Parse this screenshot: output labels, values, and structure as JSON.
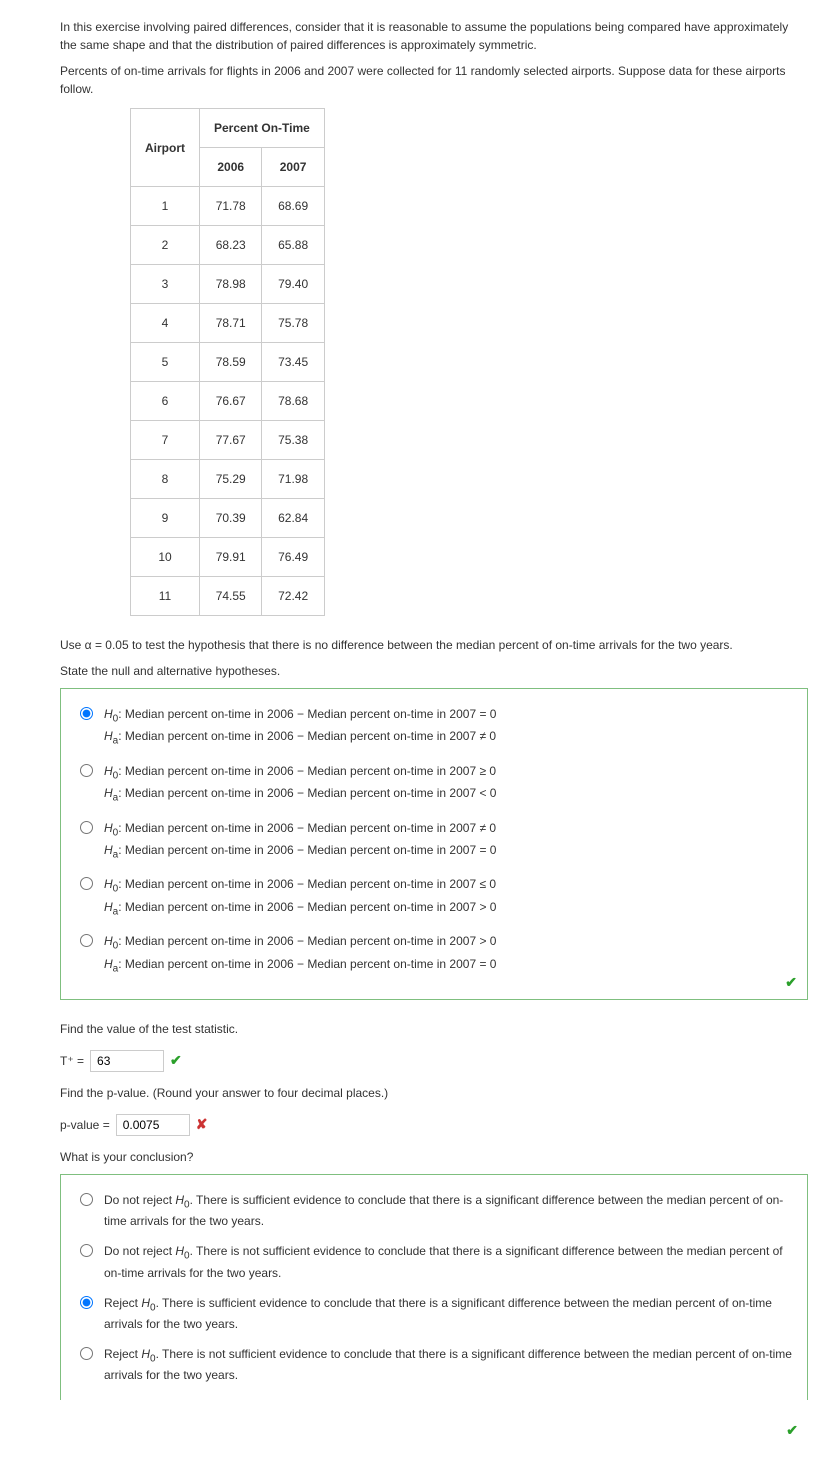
{
  "intro": {
    "p1": "In this exercise involving paired differences, consider that it is reasonable to assume the populations being compared have approximately the same shape and that the distribution of paired differences is approximately symmetric.",
    "p2": "Percents of on-time arrivals for flights in 2006 and 2007 were collected for 11 randomly selected airports. Suppose data for these airports follow."
  },
  "table": {
    "col_airport": "Airport",
    "col_group": "Percent On-Time",
    "col_2006": "2006",
    "col_2007": "2007",
    "rows": [
      {
        "airport": "1",
        "y2006": "71.78",
        "y2007": "68.69"
      },
      {
        "airport": "2",
        "y2006": "68.23",
        "y2007": "65.88"
      },
      {
        "airport": "3",
        "y2006": "78.98",
        "y2007": "79.40"
      },
      {
        "airport": "4",
        "y2006": "78.71",
        "y2007": "75.78"
      },
      {
        "airport": "5",
        "y2006": "78.59",
        "y2007": "73.45"
      },
      {
        "airport": "6",
        "y2006": "76.67",
        "y2007": "78.68"
      },
      {
        "airport": "7",
        "y2006": "77.67",
        "y2007": "75.38"
      },
      {
        "airport": "8",
        "y2006": "75.29",
        "y2007": "71.98"
      },
      {
        "airport": "9",
        "y2006": "70.39",
        "y2007": "62.84"
      },
      {
        "airport": "10",
        "y2006": "79.91",
        "y2007": "76.49"
      },
      {
        "airport": "11",
        "y2006": "74.55",
        "y2007": "72.42"
      }
    ]
  },
  "q": {
    "alpha_line": "Use α = 0.05 to test the hypothesis that there is no difference between the median percent of on-time arrivals for the two years.",
    "state_line": "State the null and alternative hypotheses.",
    "hyp": [
      {
        "h0": "Median percent on-time in 2006 − Median percent on-time in 2007 = 0",
        "ha": "Median percent on-time in 2006 − Median percent on-time in 2007 ≠ 0"
      },
      {
        "h0": "Median percent on-time in 2006 − Median percent on-time in 2007 ≥ 0",
        "ha": "Median percent on-time in 2006 − Median percent on-time in 2007 < 0"
      },
      {
        "h0": "Median percent on-time in 2006 − Median percent on-time in 2007 ≠ 0",
        "ha": "Median percent on-time in 2006 − Median percent on-time in 2007 = 0"
      },
      {
        "h0": "Median percent on-time in 2006 − Median percent on-time in 2007 ≤ 0",
        "ha": "Median percent on-time in 2006 − Median percent on-time in 2007 > 0"
      },
      {
        "h0": "Median percent on-time in 2006 − Median percent on-time in 2007 > 0",
        "ha": "Median percent on-time in 2006 − Median percent on-time in 2007 = 0"
      }
    ],
    "hyp_selected": 0,
    "find_stat": "Find the value of the test statistic.",
    "stat_prefix": "T⁺ = ",
    "stat_value": "63",
    "find_p": "Find the p-value. (Round your answer to four decimal places.)",
    "p_prefix": "p-value = ",
    "p_value": "0.0075",
    "conclusion_q": "What is your conclusion?",
    "conclusions": [
      "Do not reject H₀. There is sufficient evidence to conclude that there is a significant difference between the median percent of on-time arrivals for the two years.",
      "Do not reject H₀. There is not sufficient evidence to conclude that there is a significant difference between the median percent of on-time arrivals for the two years.",
      "Reject H₀. There is sufficient evidence to conclude that there is a significant difference between the median percent of on-time arrivals for the two years.",
      "Reject H₀. There is not sufficient evidence to conclude that there is a significant difference between the median percent of on-time arrivals for the two years."
    ],
    "conclusion_selected": 2
  },
  "labels": {
    "H0": "H₀: ",
    "Ha": "Hₐ: "
  }
}
